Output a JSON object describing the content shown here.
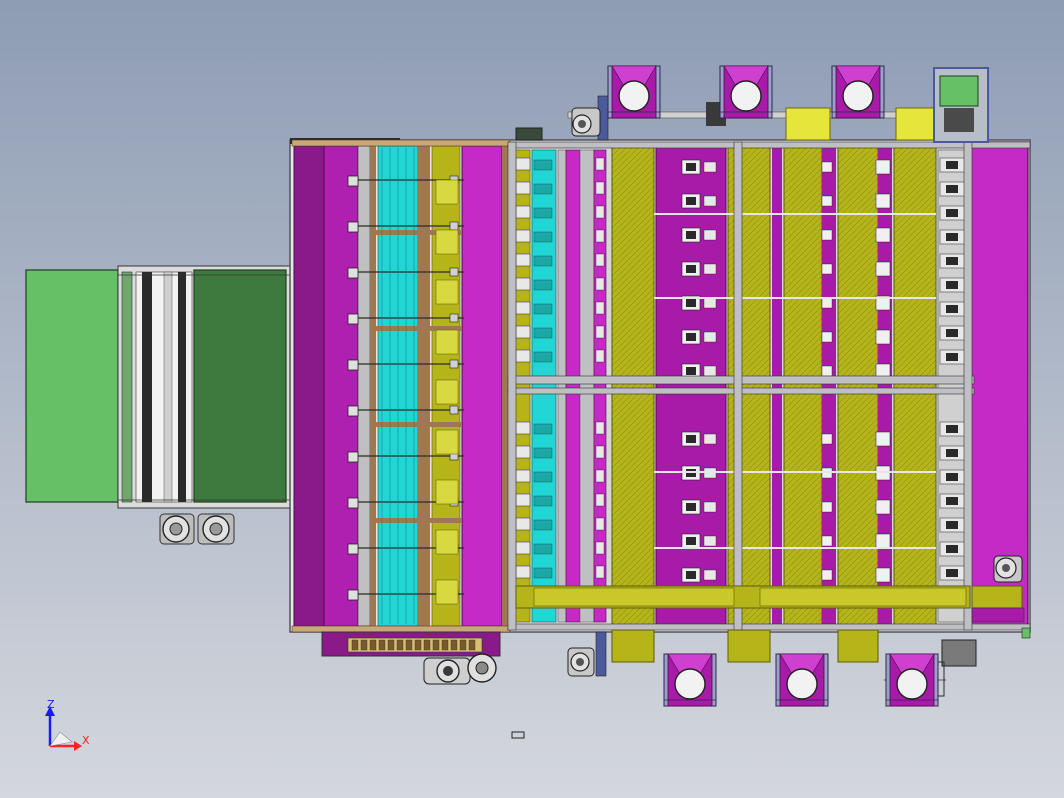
{
  "view": {
    "background_top": "#8e9cb4",
    "background_bottom": "#d4d7dd"
  },
  "colors": {
    "magenta": "#a81aa8",
    "magenta_light": "#c62ac6",
    "olive": "#b5b51a",
    "yellow_bright": "#e6e63a",
    "cyan": "#22d6d6",
    "green_light": "#66c066",
    "green_dark": "#3e7a3e",
    "frame_grey": "#bfbfc4",
    "frame_dark": "#4a4a55",
    "tan": "#a07850",
    "steel_blue": "#4a5a9a"
  },
  "triad": {
    "z_label": "Z",
    "x_label": "X",
    "z_color": "#1a1aff",
    "x_color": "#ff2020"
  }
}
